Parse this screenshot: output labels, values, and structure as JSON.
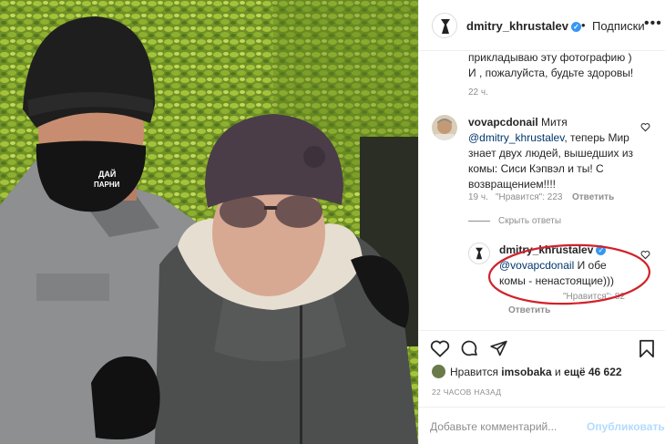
{
  "header": {
    "username": "dmitry_khrustalev",
    "follow_label": "Подписки",
    "dot": "•",
    "more": "•••"
  },
  "caption_tail": {
    "line1": "прикладываю эту фотографию )",
    "line2": "И , пожалуйста, будьте здоровы!",
    "time": "22 ч."
  },
  "comment1": {
    "username": "vovapcdonail",
    "text1": "Митя",
    "mention": "@dmitry_khrustalev",
    "text2": ", теперь Мир",
    "line3": "знает двух людей, вышедших из",
    "line4": "комы: Сиси Кэпвэл и ты! С",
    "line5": "возвращением!!!!",
    "time": "19 ч.",
    "likes": "\"Нравится\": 223",
    "reply": "Ответить"
  },
  "hide_replies": "Скрыть ответы",
  "reply1": {
    "username": "dmitry_khrustalev",
    "mention": "@vovapcdonail",
    "text1": "И обе",
    "line2": "комы - ненастоящие)))",
    "likes": "\"Нравится\": 82",
    "reply": "Ответить"
  },
  "likes_line": {
    "prefix": "Нравится",
    "user": "imsobaka",
    "middle": "и",
    "count": "ещё 46 622"
  },
  "posted_ago": "22 ЧАСОВ НАЗАД",
  "comment_box": {
    "placeholder": "Добавьте комментарий...",
    "publish": "Опубликовать"
  },
  "photo_text": {
    "mask_label1": "ДАЙ",
    "mask_label2": "ПАРНИ"
  },
  "colors": {
    "link": "#00376b",
    "verified": "#3897f0",
    "publish_disabled": "#b3dbff",
    "annotation_red": "#d0222b"
  }
}
